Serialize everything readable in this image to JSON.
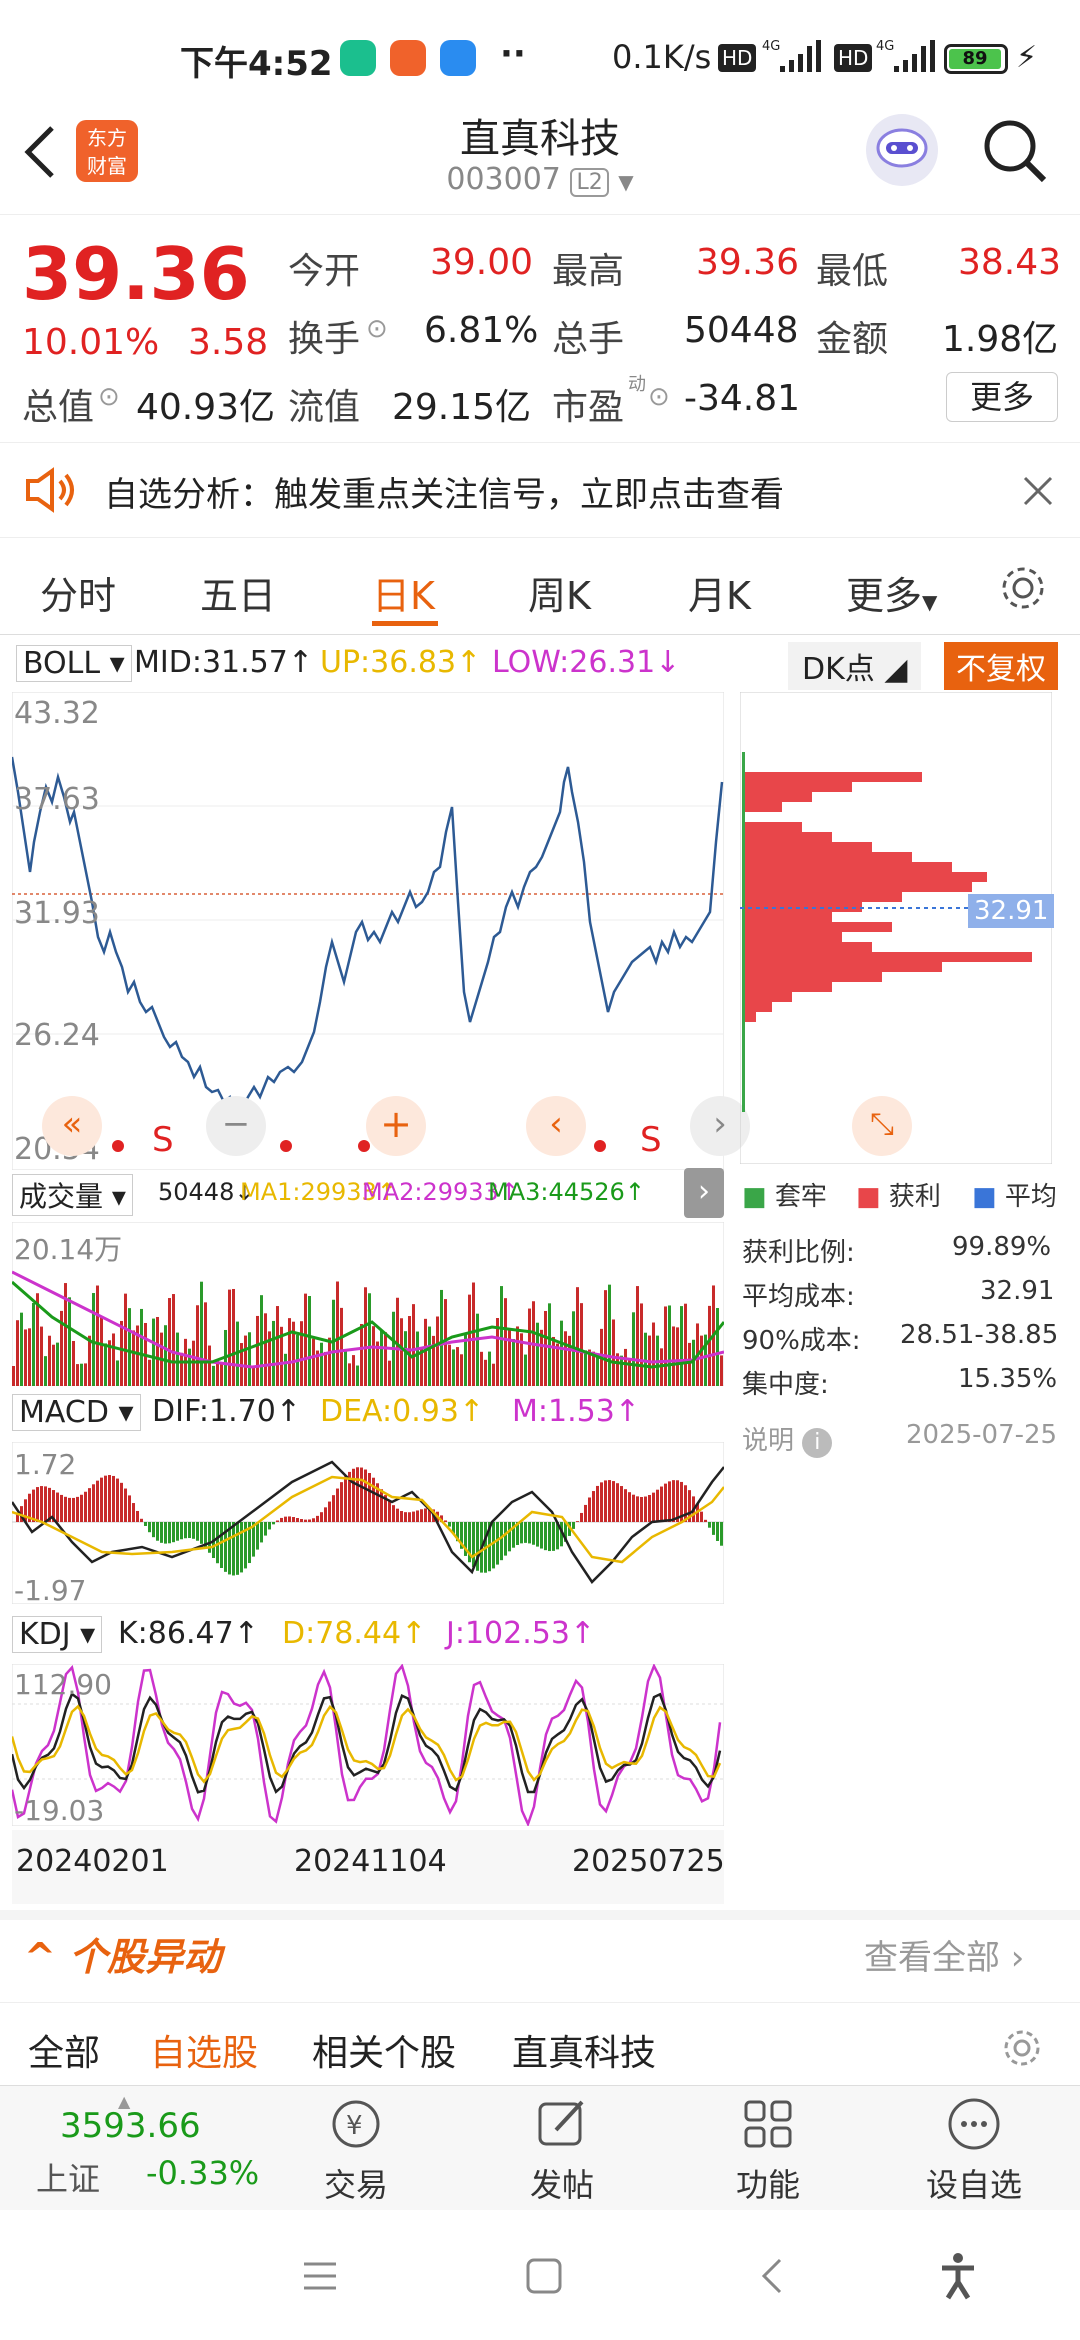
{
  "status_bar": {
    "time": "下午4:52",
    "net_speed": "0.1K/s",
    "battery": "89"
  },
  "header": {
    "title": "直真科技",
    "code": "003007",
    "level": "L2"
  },
  "quote": {
    "price": "39.36",
    "change_pct": "10.01%",
    "change": "3.58",
    "open_label": "今开",
    "open": "39.00",
    "high_label": "最高",
    "high": "39.36",
    "low_label": "最低",
    "low": "38.43",
    "turnover_label": "换手",
    "turnover": "6.81%",
    "volume_label": "总手",
    "volume": "50448",
    "amount_label": "金额",
    "amount": "1.98亿",
    "mktcap_label": "总值",
    "mktcap": "40.93亿",
    "float_label": "流值",
    "float": "29.15亿",
    "pe_label": "市盈",
    "pe_sup": "动",
    "pe": "-34.81",
    "more": "更多"
  },
  "banner": {
    "text": "自选分析：触发重点关注信号，立即点击查看"
  },
  "tabs": [
    "分时",
    "五日",
    "日K",
    "周K",
    "月K",
    "更多"
  ],
  "active_tab": "日K",
  "boll": {
    "name": "BOLL",
    "mid": "MID:31.57",
    "up": "UP:36.83",
    "low": "LOW:26.31",
    "dk": "DK点",
    "adjust": "不复权"
  },
  "price_axis": [
    "43.32",
    "37.63",
    "31.93",
    "26.24",
    "20.54"
  ],
  "signal_label": "S",
  "volume": {
    "name": "成交量",
    "vol": "50448",
    "ma1": "MA1:29933",
    "ma2": "MA2:29933",
    "ma3": "MA3:44526",
    "axis": "20.14万"
  },
  "macd": {
    "name": "MACD",
    "dif": "DIF:1.70",
    "dea": "DEA:0.93",
    "m": "M:1.53",
    "axis_top": "1.72",
    "axis_bottom": "-1.97"
  },
  "kdj": {
    "name": "KDJ",
    "k": "K:86.47",
    "d": "D:78.44",
    "j": "J:102.53",
    "axis_top": "112.90",
    "axis_bottom": "-19.03"
  },
  "dates": [
    "20240201",
    "20241104",
    "20250725"
  ],
  "chip": {
    "avg_label": "32.91",
    "legend": [
      "套牢",
      "获利",
      "平均"
    ],
    "stats": [
      {
        "label": "获利比例:",
        "value": "99.89%"
      },
      {
        "label": "平均成本:",
        "value": "32.91"
      },
      {
        "label": "90%成本:",
        "value": "28.51-38.85"
      },
      {
        "label": "集中度:",
        "value": "15.35%"
      }
    ],
    "note_label": "说明",
    "note_date": "2025-07-25"
  },
  "section": {
    "title": "个股异动",
    "more": "查看全部"
  },
  "filters": [
    "全部",
    "自选股",
    "相关个股",
    "直真科技"
  ],
  "active_filter": "自选股",
  "index": {
    "value": "3593.66",
    "name": "上证",
    "change": "-0.33%"
  },
  "nav": [
    "交易",
    "发帖",
    "功能",
    "设自选"
  ],
  "colors": {
    "accent": "#e8620f",
    "up": "#e02222",
    "down": "#1a9a1a",
    "line": "#2d5a94"
  }
}
